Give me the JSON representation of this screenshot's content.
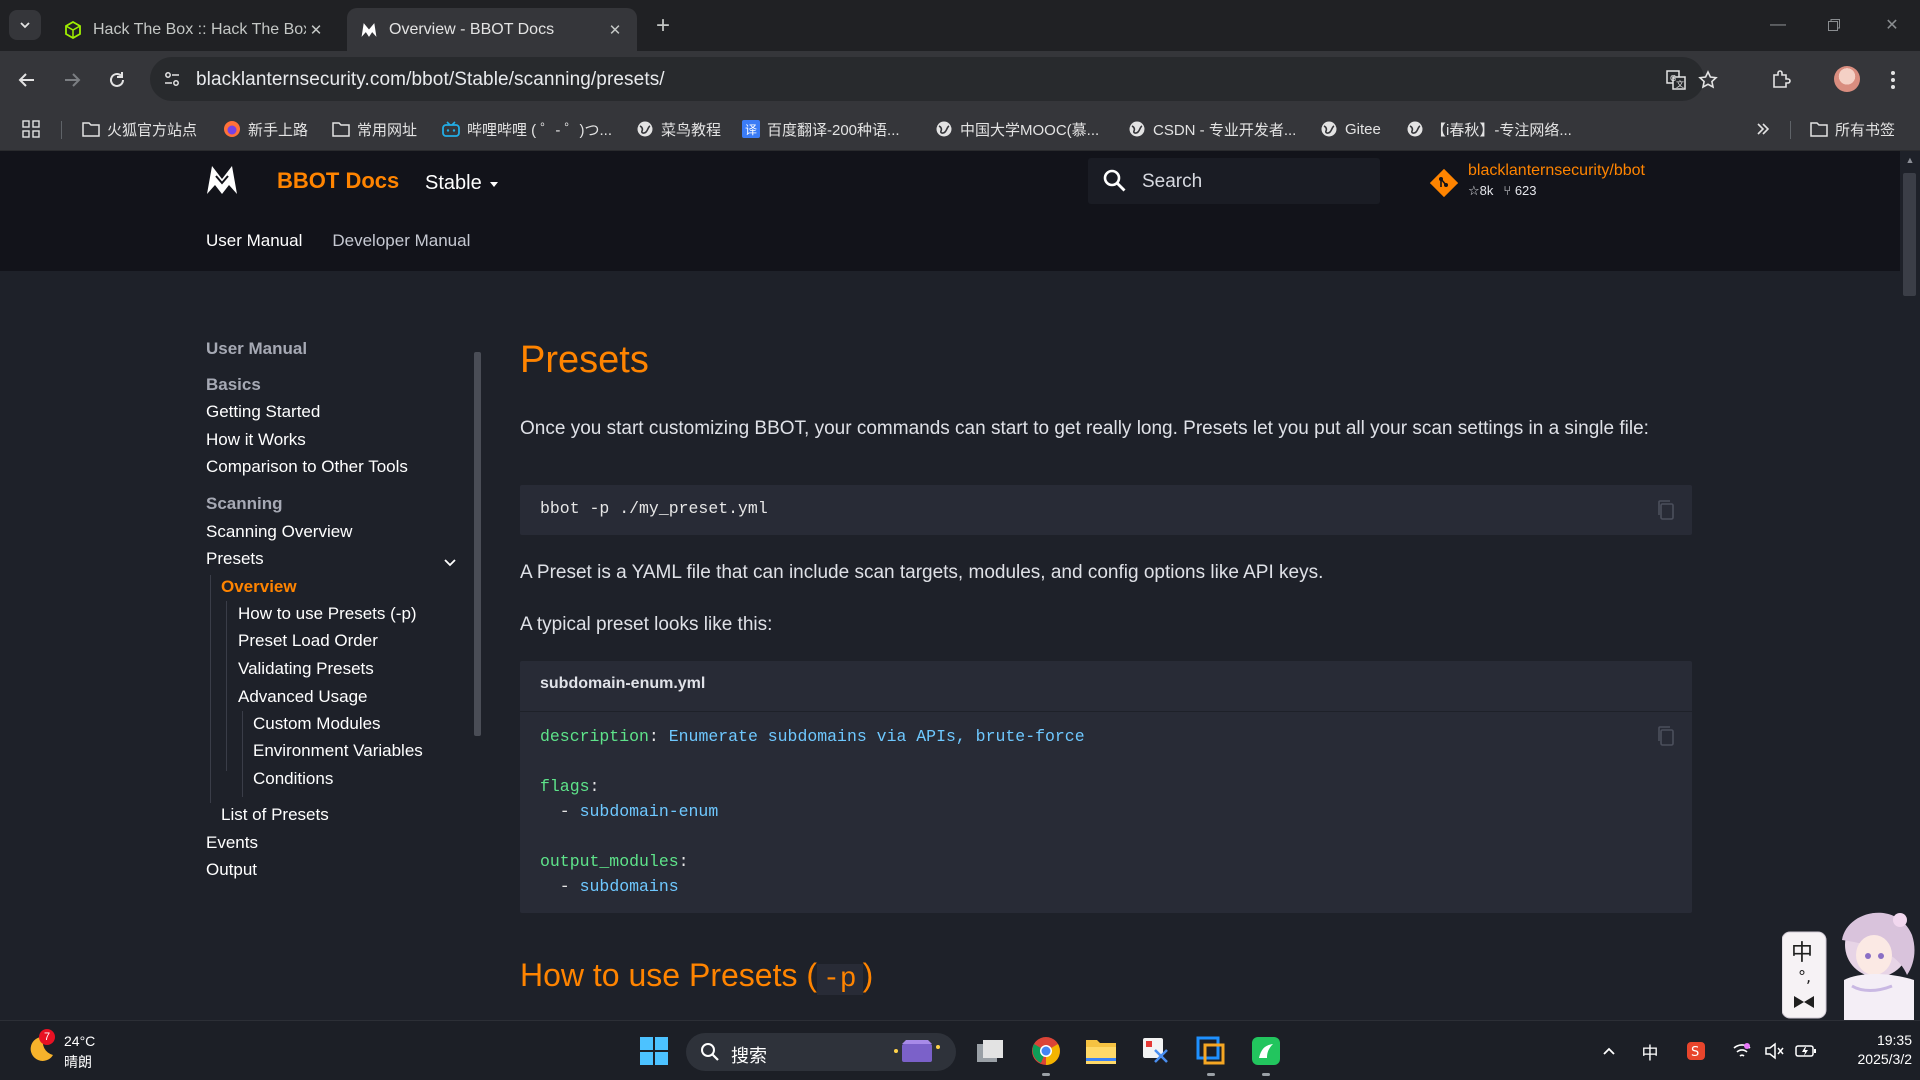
{
  "browser": {
    "tabs": [
      {
        "title": "Hack The Box :: Hack The Box",
        "active": false
      },
      {
        "title": "Overview - BBOT Docs",
        "active": true
      }
    ],
    "url": "blacklanternsecurity.com/bbot/Stable/scanning/presets/",
    "bookmarks": [
      {
        "label": "火狐官方站点",
        "icon": "folder-icon"
      },
      {
        "label": "新手上路",
        "icon": "firefox-icon"
      },
      {
        "label": "常用网址",
        "icon": "folder-icon"
      },
      {
        "label": "哔哩哔哩 ( ゜- ゜)つ...",
        "icon": "bilibili-icon"
      },
      {
        "label": "菜鸟教程",
        "icon": "globe-icon"
      },
      {
        "label": "百度翻译-200种语...",
        "icon": "translate-icon"
      },
      {
        "label": "中国大学MOOC(慕...",
        "icon": "globe-icon"
      },
      {
        "label": "CSDN - 专业开发者...",
        "icon": "globe-icon"
      },
      {
        "label": "Gitee",
        "icon": "globe-icon"
      },
      {
        "label": "【i春秋】-专注网络...",
        "icon": "globe-icon"
      }
    ],
    "all_bookmarks": "所有书签"
  },
  "site": {
    "name": "BBOT Docs",
    "version": "Stable",
    "search_placeholder": "Search",
    "repo": {
      "name": "blacklanternsecurity/bbot",
      "stars": "8k",
      "forks": "623"
    },
    "tabs": [
      {
        "label": "User Manual",
        "current": true
      },
      {
        "label": "Developer Manual",
        "current": false
      }
    ]
  },
  "sidebar": {
    "title": "User Manual",
    "sections": {
      "basics": "Basics",
      "scanning": "Scanning"
    },
    "items": {
      "getting_started": "Getting Started",
      "how_it_works": "How it Works",
      "comparison": "Comparison to Other Tools",
      "scanning_overview": "Scanning Overview",
      "presets": "Presets",
      "overview": "Overview",
      "how_to_use": "How to use Presets (-p)",
      "load_order": "Preset Load Order",
      "validating": "Validating Presets",
      "advanced": "Advanced Usage",
      "custom_modules": "Custom Modules",
      "env_vars": "Environment Variables",
      "conditions": "Conditions",
      "list_presets": "List of Presets",
      "events": "Events",
      "output": "Output"
    }
  },
  "content": {
    "title": "Presets",
    "intro": "Once you start customizing BBOT, your commands can start to get really long. Presets let you put all your scan settings in a single file:",
    "command": "bbot -p ./my_preset.yml",
    "p2": "A Preset is a YAML file that can include scan targets, modules, and config options like API keys.",
    "p3": "A typical preset looks like this:",
    "yaml": {
      "filename": "subdomain-enum.yml",
      "description_key": "description",
      "description_value": "Enumerate subdomains via APIs, brute-force",
      "flags_key": "flags",
      "flags_value": "subdomain-enum",
      "output_key": "output_modules",
      "output_value": "subdomains"
    },
    "next_heading_text": "How to use Presets (",
    "next_heading_code": "-p",
    "next_heading_end": ")"
  },
  "taskbar": {
    "weather": {
      "temp": "24°C",
      "condition": "晴朗",
      "badge": "7"
    },
    "search_placeholder": "搜索",
    "ime": "中",
    "clock_time": "19:35",
    "clock_date": "2025/3/2"
  },
  "widget": {
    "ime_char": "中"
  }
}
